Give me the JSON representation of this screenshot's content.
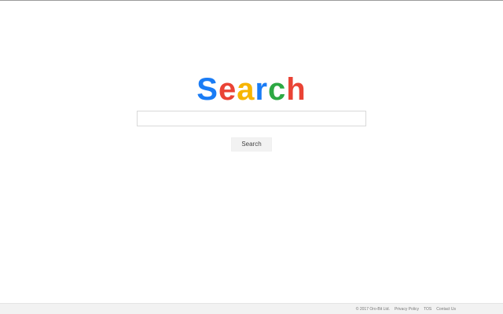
{
  "logo": {
    "letters": [
      {
        "char": "S",
        "color": "#1a7cf5"
      },
      {
        "char": "e",
        "color": "#ea4335"
      },
      {
        "char": "a",
        "color": "#f7b500"
      },
      {
        "char": "r",
        "color": "#1a7cf5"
      },
      {
        "char": "c",
        "color": "#2da843"
      },
      {
        "char": "h",
        "color": "#ea4335"
      }
    ]
  },
  "search": {
    "value": "",
    "placeholder": "",
    "button_label": "Search"
  },
  "footer": {
    "copyright": "© 2017 Oro-Bit Ltd.",
    "links": [
      {
        "label": "Privacy Policy"
      },
      {
        "label": "TOS"
      },
      {
        "label": "Contact Us"
      }
    ]
  },
  "colors": {
    "background": "#ffffff",
    "footer_background": "#f2f2f2",
    "button_background": "#f2f2f2"
  }
}
